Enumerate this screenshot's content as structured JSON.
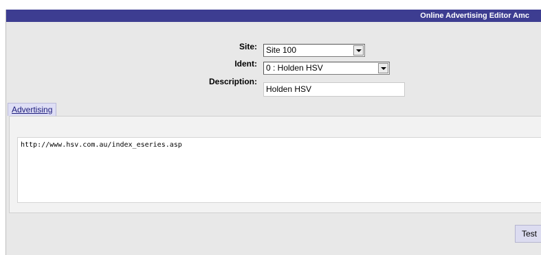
{
  "header": {
    "title": "Online Advertising Editor Amc"
  },
  "form": {
    "site": {
      "label": "Site:",
      "value": "Site 100"
    },
    "ident": {
      "label": "Ident:",
      "value": "0 : Holden HSV"
    },
    "description": {
      "label": "Description:",
      "value": "Holden HSV"
    }
  },
  "tabs": [
    {
      "label": "Advertising"
    }
  ],
  "advertising": {
    "url": "http://www.hsv.com.au/index_eseries.asp"
  },
  "buttons": {
    "test_label": "Test"
  }
}
